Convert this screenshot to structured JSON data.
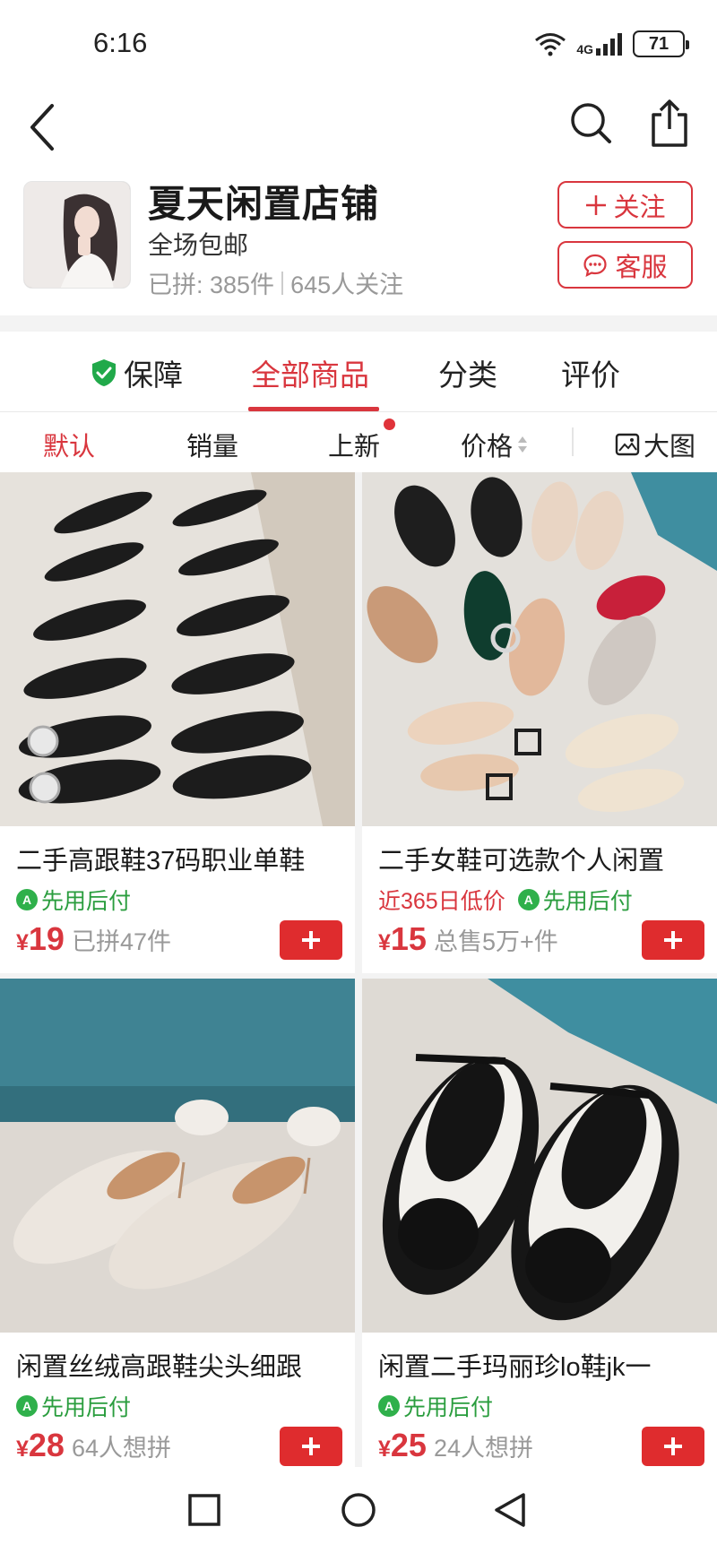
{
  "status_bar": {
    "time": "6:16",
    "network": "4G",
    "battery": "71"
  },
  "nav": {
    "back_icon": "chevron-left-icon",
    "search_icon": "search-icon",
    "share_icon": "share-icon"
  },
  "shop": {
    "name": "夏天闲置店铺",
    "slogan": "全场包邮",
    "sold_stat": "已拼: 385件",
    "follower_stat": "645人关注",
    "follow_label": "关注",
    "service_label": "客服"
  },
  "tabs": [
    {
      "label": "保障"
    },
    {
      "label": "全部商品"
    },
    {
      "label": "分类"
    },
    {
      "label": "评价"
    }
  ],
  "sort_options": [
    {
      "label": "默认"
    },
    {
      "label": "销量"
    },
    {
      "label": "上新"
    },
    {
      "label": "价格"
    },
    {
      "label": "大图"
    }
  ],
  "products": [
    {
      "title": "二手高跟鞋37码职业单鞋",
      "tags": {
        "low_price": "",
        "pay_later": "先用后付"
      },
      "currency": "¥",
      "price": "19",
      "sales": "已拼47件"
    },
    {
      "title": "二手女鞋可选款个人闲置",
      "tags": {
        "low_price": "近365日低价",
        "pay_later": "先用后付"
      },
      "currency": "¥",
      "price": "15",
      "sales": "总售5万+件"
    },
    {
      "title": "闲置丝绒高跟鞋尖头细跟",
      "tags": {
        "low_price": "",
        "pay_later": "先用后付"
      },
      "currency": "¥",
      "price": "28",
      "sales": "64人想拼"
    },
    {
      "title": "闲置二手玛丽珍lo鞋jk一",
      "tags": {
        "low_price": "",
        "pay_later": "先用后付"
      },
      "currency": "¥",
      "price": "25",
      "sales": "24人想拼"
    }
  ],
  "colors": {
    "accent": "#d9363e",
    "pay_green": "#2a9d3e"
  }
}
